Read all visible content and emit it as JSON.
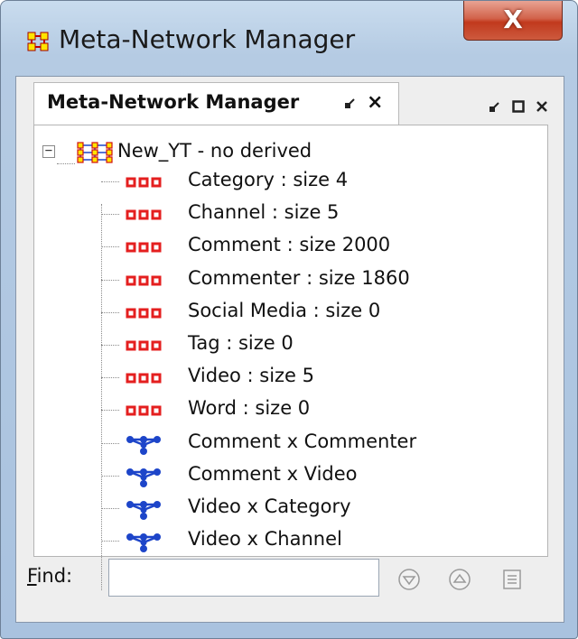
{
  "window": {
    "title": "Meta-Network Manager",
    "close_label": "X",
    "icon": "meta-network-icon"
  },
  "tab": {
    "label": "Meta-Network Manager",
    "pin_icon": "pin-icon",
    "close_label": "×"
  },
  "frame_controls": {
    "pin": "↙",
    "maximize": "□",
    "close": "×"
  },
  "tree": {
    "expander": "−",
    "root": {
      "label": "New_YT - no derived",
      "icon": "meta-network-icon"
    },
    "items": [
      {
        "label": "Category : size 4",
        "icon": "nodeset-icon"
      },
      {
        "label": "Channel : size 5",
        "icon": "nodeset-icon"
      },
      {
        "label": "Comment : size 2000",
        "icon": "nodeset-icon"
      },
      {
        "label": "Commenter : size 1860",
        "icon": "nodeset-icon"
      },
      {
        "label": "Social Media : size 0",
        "icon": "nodeset-icon"
      },
      {
        "label": "Tag : size 0",
        "icon": "nodeset-icon"
      },
      {
        "label": "Video : size 5",
        "icon": "nodeset-icon"
      },
      {
        "label": "Word : size 0",
        "icon": "nodeset-icon"
      },
      {
        "label": "Comment x Commenter",
        "icon": "network-icon"
      },
      {
        "label": "Comment x Video",
        "icon": "network-icon"
      },
      {
        "label": "Video x Category",
        "icon": "network-icon"
      },
      {
        "label": "Video x Channel",
        "icon": "network-icon"
      }
    ]
  },
  "find": {
    "label": "Find:",
    "value": "",
    "placeholder": "",
    "buttons": [
      "find-next-icon",
      "find-previous-icon",
      "find-list-icon"
    ]
  },
  "colors": {
    "nodeset": "#e41f1f",
    "network": "#1d45c9",
    "accent": "#c1391d"
  }
}
